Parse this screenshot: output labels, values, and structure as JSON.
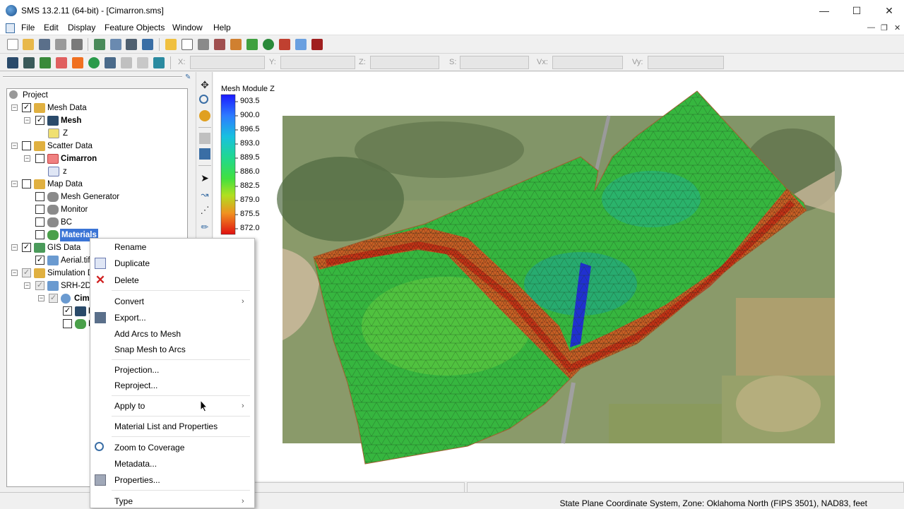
{
  "window": {
    "title": "SMS 13.2.11 (64-bit) - [Cimarron.sms]",
    "minimize": "—",
    "maximize": "☐",
    "close": "✕"
  },
  "menubar": {
    "items": [
      "File",
      "Edit",
      "Display",
      "Feature Objects",
      "Window",
      "Help"
    ],
    "mdi_minimize": "—",
    "mdi_restore": "❐",
    "mdi_close": "✕"
  },
  "coords": {
    "x_label": "X:",
    "y_label": "Y:",
    "z_label": "Z:",
    "s_label": "S:",
    "vx_label": "Vx:",
    "vy_label": "Vy:"
  },
  "tree": {
    "project": "Project",
    "mesh_data": "Mesh Data",
    "mesh": "Mesh",
    "mesh_z": "Z",
    "scatter_data": "Scatter Data",
    "cimarron": "Cimarron",
    "scatter_z": "z",
    "map_data": "Map Data",
    "mesh_generator": "Mesh Generator",
    "monitor": "Monitor",
    "bc": "BC",
    "materials": "Materials",
    "gis_data": "GIS Data",
    "aerial": "Aerial.tif",
    "simulation_data": "Simulation Da",
    "srh2d": "SRH-2D",
    "cima": "Cima",
    "sub1": "M",
    "sub2": "B"
  },
  "context_menu": {
    "rename": "Rename",
    "duplicate": "Duplicate",
    "delete": "Delete",
    "convert": "Convert",
    "export": "Export...",
    "add_arcs": "Add Arcs to Mesh",
    "snap_mesh": "Snap Mesh to Arcs",
    "projection": "Projection...",
    "reproject": "Reproject...",
    "apply_to": "Apply to",
    "material_list": "Material List and Properties",
    "zoom_coverage": "Zoom to Coverage",
    "metadata": "Metadata...",
    "properties": "Properties...",
    "type": "Type",
    "submenu_arrow": "›"
  },
  "legend": {
    "title": "Mesh Module Z",
    "values": [
      "903.5",
      "900.0",
      "896.5",
      "893.0",
      "889.5",
      "886.0",
      "882.5",
      "879.0",
      "875.5",
      "872.0"
    ],
    "colors": [
      "#1a1aff",
      "#2d7bff",
      "#18c0e0",
      "#20d890",
      "#30e040",
      "#70e030",
      "#c0e020",
      "#f0b020",
      "#f06020",
      "#e01010"
    ]
  },
  "status": {
    "text": "State Plane Coordinate System, Zone: Oklahoma North (FIPS 3501), NAD83, feet"
  }
}
